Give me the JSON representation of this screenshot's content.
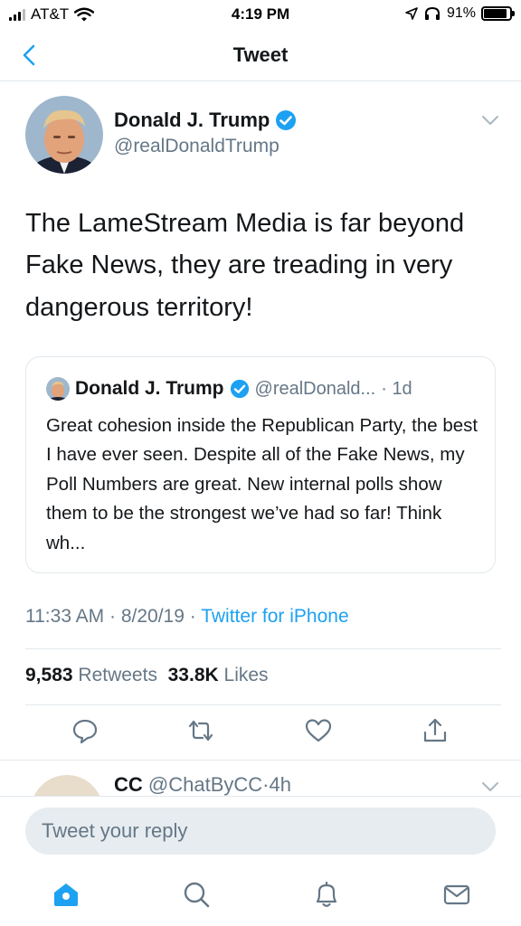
{
  "status_bar": {
    "carrier": "AT&T",
    "time": "4:19 PM",
    "battery": "91%",
    "battery_level": 0.91
  },
  "nav": {
    "title": "Tweet"
  },
  "tweet": {
    "author_name": "Donald J. Trump",
    "author_handle": "@realDonaldTrump",
    "text": "The LameStream Media is far beyond Fake News, they are treading in very dangerous territory!",
    "time": "11:33 AM",
    "date": "8/20/19",
    "source": "Twitter for iPhone",
    "retweets_count": "9,583",
    "retweets_label": "Retweets",
    "likes_count": "33.8K",
    "likes_label": "Likes"
  },
  "quoted_tweet": {
    "author_name": "Donald J. Trump",
    "author_handle": "@realDonald...",
    "time": "1d",
    "text": "Great cohesion inside the Republican Party, the best I have ever seen. Despite all of the Fake News, my Poll Numbers are great. New internal polls show them to be the strongest we’ve had so far! Think wh..."
  },
  "next_reply": {
    "author_name": "CC",
    "author_handle": "@ChatByCC",
    "time": "4h"
  },
  "composer": {
    "placeholder": "Tweet your reply"
  },
  "colors": {
    "accent": "#1da1f2",
    "secondary_text": "#657786",
    "divider": "#e1e8ed"
  }
}
